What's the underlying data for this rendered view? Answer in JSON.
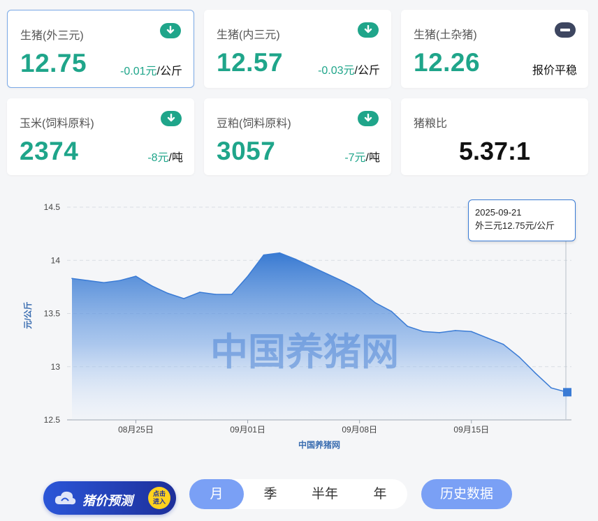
{
  "cards": [
    {
      "label": "生猪(外三元)",
      "value": "12.75",
      "delta": "-0.01元",
      "unit": "/公斤",
      "trend": "down-icon"
    },
    {
      "label": "生猪(内三元)",
      "value": "12.57",
      "delta": "-0.03元",
      "unit": "/公斤",
      "trend": "down-icon"
    },
    {
      "label": "生猪(土杂猪)",
      "value": "12.26",
      "flat_text": "报价平稳",
      "trend": "flat-icon"
    },
    {
      "label": "玉米(饲料原料)",
      "value": "2374",
      "delta": "-8元",
      "unit": "/吨",
      "trend": "down-icon"
    },
    {
      "label": "豆粕(饲料原料)",
      "value": "3057",
      "delta": "-7元",
      "unit": "/吨",
      "trend": "down-icon"
    },
    {
      "label": "猪粮比",
      "value": "5.37:1"
    }
  ],
  "colors": {
    "accent_green": "#1fa58a",
    "chart_blue": "#3a7bd5",
    "button_blue": "#7aa0f5",
    "flat_icon": "#3d4660"
  },
  "chart_data": {
    "type": "area",
    "title": "",
    "watermark": "中国养猪网",
    "xlabel": "中国养猪网",
    "ylabel": "元/公斤",
    "ylim": [
      12.5,
      14.5
    ],
    "yticks": [
      "14.5",
      "14",
      "13.5",
      "13",
      "12.5"
    ],
    "xtick_labels": [
      "08月25日",
      "09月01日",
      "09月08日",
      "09月15日"
    ],
    "xtick_dates": [
      "2025-08-25",
      "2025-09-01",
      "2025-09-08",
      "2025-09-15"
    ],
    "grid": true,
    "series": [
      {
        "x": [
          "2025-08-21",
          "2025-08-22",
          "2025-08-23",
          "2025-08-24",
          "2025-08-25",
          "2025-08-26",
          "2025-08-27",
          "2025-08-28",
          "2025-08-29",
          "2025-08-30",
          "2025-08-31",
          "2025-09-01",
          "2025-09-02",
          "2025-09-03",
          "2025-09-04",
          "2025-09-05",
          "2025-09-06",
          "2025-09-07",
          "2025-09-08",
          "2025-09-09",
          "2025-09-10",
          "2025-09-11",
          "2025-09-12",
          "2025-09-13",
          "2025-09-14",
          "2025-09-15",
          "2025-09-16",
          "2025-09-17",
          "2025-09-18",
          "2025-09-19",
          "2025-09-20",
          "2025-09-21"
        ],
        "values": [
          13.83,
          13.81,
          13.79,
          13.81,
          13.85,
          13.76,
          13.69,
          13.64,
          13.7,
          13.68,
          13.68,
          13.85,
          14.05,
          14.07,
          14.01,
          13.94,
          13.87,
          13.8,
          13.72,
          13.6,
          13.52,
          13.38,
          13.33,
          13.32,
          13.34,
          13.33,
          13.27,
          13.21,
          13.09,
          12.94,
          12.8,
          12.76
        ]
      }
    ]
  },
  "tooltip": {
    "date": "2025-09-21",
    "text": "外三元12.75元/公斤"
  },
  "forecast": {
    "text": "猪价预测",
    "badge_line1": "点击",
    "badge_line2": "进入"
  },
  "periods": [
    "月",
    "季",
    "半年",
    "年"
  ],
  "history_label": "历史数据"
}
